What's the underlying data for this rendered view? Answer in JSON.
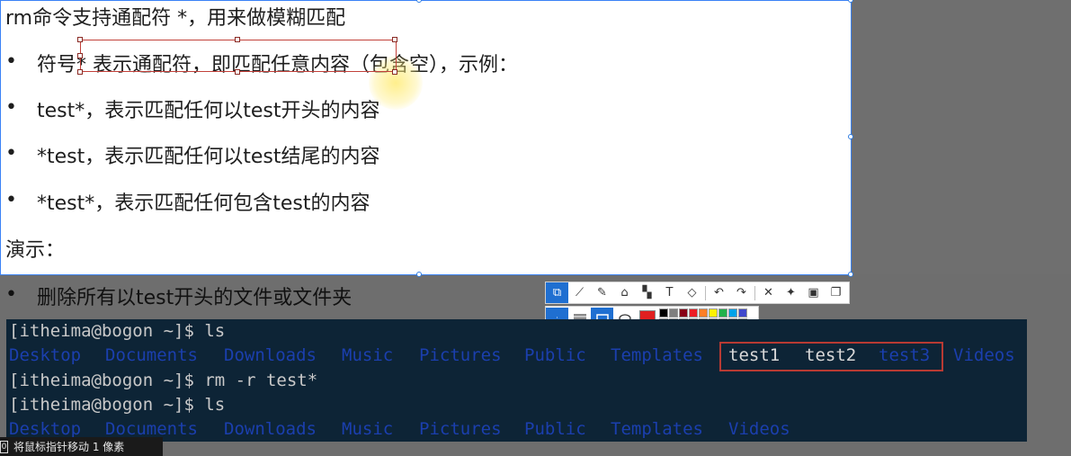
{
  "slide": {
    "title": "rm命令支持通配符 *，用来做模糊匹配",
    "bullets": [
      "符号* 表示通配符，即匹配任意内容（包含空），示例：",
      "test*，表示匹配任何以test开头的内容",
      "*test，表示匹配任何以test结尾的内容",
      "*test*，表示匹配任何包含test的内容"
    ],
    "demo_label": "演示：",
    "demo_bullet": "删除所有以test开头的文件或文件夹",
    "bullet_char": "•"
  },
  "toolbar": {
    "tools": [
      {
        "icon": "rect-select-icon",
        "glyph": "⧉"
      },
      {
        "icon": "polyline-icon",
        "glyph": "⟋"
      },
      {
        "icon": "pencil-icon",
        "glyph": "✎"
      },
      {
        "icon": "highlighter-icon",
        "glyph": "⌂"
      },
      {
        "icon": "mosaic-icon",
        "glyph": "▚"
      },
      {
        "icon": "text-icon",
        "glyph": "T"
      },
      {
        "icon": "eraser-icon",
        "glyph": "◇"
      },
      {
        "icon": "undo-icon",
        "glyph": "↶"
      },
      {
        "icon": "redo-icon",
        "glyph": "↷"
      },
      {
        "icon": "close-icon",
        "glyph": "✕"
      },
      {
        "icon": "pin-icon",
        "glyph": "✦"
      },
      {
        "icon": "save-icon",
        "glyph": "▣"
      },
      {
        "icon": "copy-icon",
        "glyph": "❐"
      }
    ],
    "current_color": "#e02020",
    "palette": [
      "#000000",
      "#7f7f7f",
      "#880015",
      "#ed1c24",
      "#ff7f27",
      "#fff200",
      "#22b14c",
      "#00a2e8",
      "#3f48cc",
      "#ffffff",
      "#c3c3c3",
      "#b97a57",
      "#ffaec9",
      "#ffc90e",
      "#efe4b0",
      "#b5e61d",
      "#99d9ea",
      "#7092be"
    ]
  },
  "terminal": {
    "lines": [
      {
        "prompt": "[itheima@bogon ~]$ ",
        "cmd": "ls"
      },
      {
        "prompt": "[itheima@bogon ~]$ ",
        "cmd": "rm -r test*"
      },
      {
        "prompt": "[itheima@bogon ~]$ ",
        "cmd": "ls"
      }
    ],
    "ls1": [
      "Desktop",
      "Documents",
      "Downloads",
      "Music",
      "Pictures",
      "Public",
      "Templates",
      "test1",
      "test2",
      "test3",
      "Videos"
    ],
    "ls2": [
      "Desktop",
      "Documents",
      "Downloads",
      "Music",
      "Pictures",
      "Public",
      "Templates",
      "Videos"
    ]
  },
  "status": {
    "text": "将鼠标指针移动 1 像素"
  }
}
